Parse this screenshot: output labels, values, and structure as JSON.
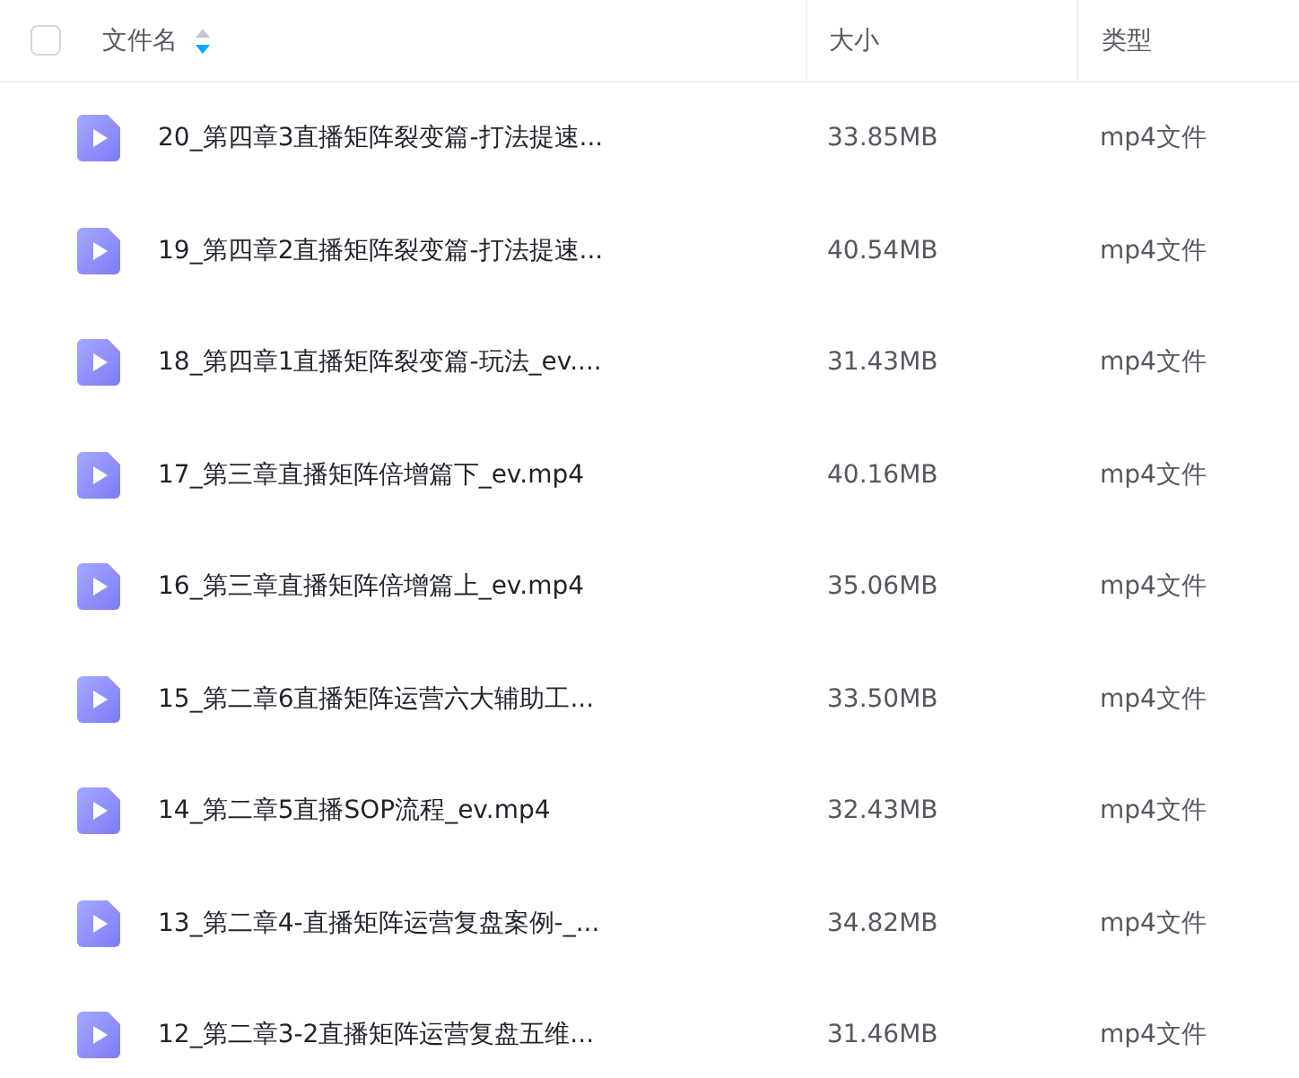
{
  "header": {
    "select_all": {
      "checked": false
    },
    "columns": [
      {
        "label": "文件名",
        "sorted": true,
        "descending": true
      },
      {
        "label": "大小"
      },
      {
        "label": "类型"
      }
    ]
  },
  "rows": [
    {
      "name": "20_第四章3直播矩阵裂变篇-打法提速...",
      "size": "33.85MB",
      "type": "mp4文件"
    },
    {
      "name": "19_第四章2直播矩阵裂变篇-打法提速...",
      "size": "40.54MB",
      "type": "mp4文件"
    },
    {
      "name": "18_第四章1直播矩阵裂变篇-玩法_ev....",
      "size": "31.43MB",
      "type": "mp4文件"
    },
    {
      "name": "17_第三章直播矩阵倍增篇下_ev.mp4",
      "size": "40.16MB",
      "type": "mp4文件"
    },
    {
      "name": "16_第三章直播矩阵倍增篇上_ev.mp4",
      "size": "35.06MB",
      "type": "mp4文件"
    },
    {
      "name": "15_第二章6直播矩阵运营六大辅助工...",
      "size": "33.50MB",
      "type": "mp4文件"
    },
    {
      "name": "14_第二章5直播SOP流程_ev.mp4",
      "size": "32.43MB",
      "type": "mp4文件"
    },
    {
      "name": "13_第二章4-直播矩阵运营复盘案例-_...",
      "size": "34.82MB",
      "type": "mp4文件"
    },
    {
      "name": "12_第二章3-2直播矩阵运营复盘五维...",
      "size": "31.46MB",
      "type": "mp4文件"
    }
  ]
}
